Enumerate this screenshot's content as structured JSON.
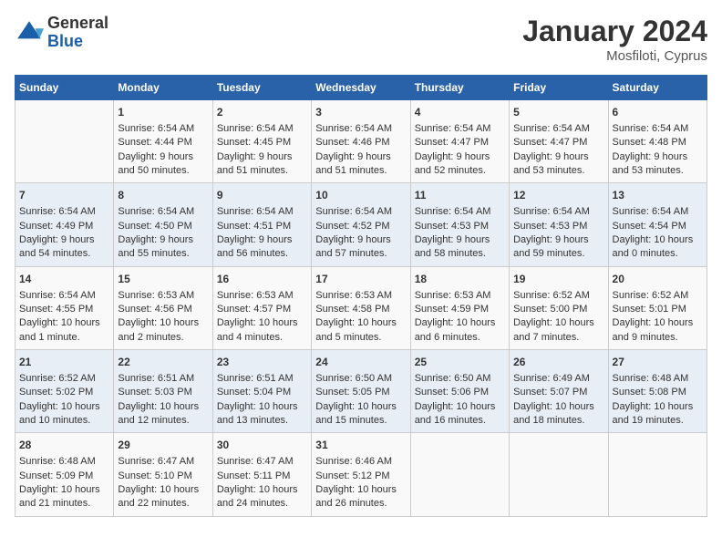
{
  "header": {
    "logo_general": "General",
    "logo_blue": "Blue",
    "month_title": "January 2024",
    "location": "Mosfiloti, Cyprus"
  },
  "weekdays": [
    "Sunday",
    "Monday",
    "Tuesday",
    "Wednesday",
    "Thursday",
    "Friday",
    "Saturday"
  ],
  "weeks": [
    [
      {
        "day": "",
        "content": ""
      },
      {
        "day": "1",
        "content": "Sunrise: 6:54 AM\nSunset: 4:44 PM\nDaylight: 9 hours\nand 50 minutes."
      },
      {
        "day": "2",
        "content": "Sunrise: 6:54 AM\nSunset: 4:45 PM\nDaylight: 9 hours\nand 51 minutes."
      },
      {
        "day": "3",
        "content": "Sunrise: 6:54 AM\nSunset: 4:46 PM\nDaylight: 9 hours\nand 51 minutes."
      },
      {
        "day": "4",
        "content": "Sunrise: 6:54 AM\nSunset: 4:47 PM\nDaylight: 9 hours\nand 52 minutes."
      },
      {
        "day": "5",
        "content": "Sunrise: 6:54 AM\nSunset: 4:47 PM\nDaylight: 9 hours\nand 53 minutes."
      },
      {
        "day": "6",
        "content": "Sunrise: 6:54 AM\nSunset: 4:48 PM\nDaylight: 9 hours\nand 53 minutes."
      }
    ],
    [
      {
        "day": "7",
        "content": "Sunrise: 6:54 AM\nSunset: 4:49 PM\nDaylight: 9 hours\nand 54 minutes."
      },
      {
        "day": "8",
        "content": "Sunrise: 6:54 AM\nSunset: 4:50 PM\nDaylight: 9 hours\nand 55 minutes."
      },
      {
        "day": "9",
        "content": "Sunrise: 6:54 AM\nSunset: 4:51 PM\nDaylight: 9 hours\nand 56 minutes."
      },
      {
        "day": "10",
        "content": "Sunrise: 6:54 AM\nSunset: 4:52 PM\nDaylight: 9 hours\nand 57 minutes."
      },
      {
        "day": "11",
        "content": "Sunrise: 6:54 AM\nSunset: 4:53 PM\nDaylight: 9 hours\nand 58 minutes."
      },
      {
        "day": "12",
        "content": "Sunrise: 6:54 AM\nSunset: 4:53 PM\nDaylight: 9 hours\nand 59 minutes."
      },
      {
        "day": "13",
        "content": "Sunrise: 6:54 AM\nSunset: 4:54 PM\nDaylight: 10 hours\nand 0 minutes."
      }
    ],
    [
      {
        "day": "14",
        "content": "Sunrise: 6:54 AM\nSunset: 4:55 PM\nDaylight: 10 hours\nand 1 minute."
      },
      {
        "day": "15",
        "content": "Sunrise: 6:53 AM\nSunset: 4:56 PM\nDaylight: 10 hours\nand 2 minutes."
      },
      {
        "day": "16",
        "content": "Sunrise: 6:53 AM\nSunset: 4:57 PM\nDaylight: 10 hours\nand 4 minutes."
      },
      {
        "day": "17",
        "content": "Sunrise: 6:53 AM\nSunset: 4:58 PM\nDaylight: 10 hours\nand 5 minutes."
      },
      {
        "day": "18",
        "content": "Sunrise: 6:53 AM\nSunset: 4:59 PM\nDaylight: 10 hours\nand 6 minutes."
      },
      {
        "day": "19",
        "content": "Sunrise: 6:52 AM\nSunset: 5:00 PM\nDaylight: 10 hours\nand 7 minutes."
      },
      {
        "day": "20",
        "content": "Sunrise: 6:52 AM\nSunset: 5:01 PM\nDaylight: 10 hours\nand 9 minutes."
      }
    ],
    [
      {
        "day": "21",
        "content": "Sunrise: 6:52 AM\nSunset: 5:02 PM\nDaylight: 10 hours\nand 10 minutes."
      },
      {
        "day": "22",
        "content": "Sunrise: 6:51 AM\nSunset: 5:03 PM\nDaylight: 10 hours\nand 12 minutes."
      },
      {
        "day": "23",
        "content": "Sunrise: 6:51 AM\nSunset: 5:04 PM\nDaylight: 10 hours\nand 13 minutes."
      },
      {
        "day": "24",
        "content": "Sunrise: 6:50 AM\nSunset: 5:05 PM\nDaylight: 10 hours\nand 15 minutes."
      },
      {
        "day": "25",
        "content": "Sunrise: 6:50 AM\nSunset: 5:06 PM\nDaylight: 10 hours\nand 16 minutes."
      },
      {
        "day": "26",
        "content": "Sunrise: 6:49 AM\nSunset: 5:07 PM\nDaylight: 10 hours\nand 18 minutes."
      },
      {
        "day": "27",
        "content": "Sunrise: 6:48 AM\nSunset: 5:08 PM\nDaylight: 10 hours\nand 19 minutes."
      }
    ],
    [
      {
        "day": "28",
        "content": "Sunrise: 6:48 AM\nSunset: 5:09 PM\nDaylight: 10 hours\nand 21 minutes."
      },
      {
        "day": "29",
        "content": "Sunrise: 6:47 AM\nSunset: 5:10 PM\nDaylight: 10 hours\nand 22 minutes."
      },
      {
        "day": "30",
        "content": "Sunrise: 6:47 AM\nSunset: 5:11 PM\nDaylight: 10 hours\nand 24 minutes."
      },
      {
        "day": "31",
        "content": "Sunrise: 6:46 AM\nSunset: 5:12 PM\nDaylight: 10 hours\nand 26 minutes."
      },
      {
        "day": "",
        "content": ""
      },
      {
        "day": "",
        "content": ""
      },
      {
        "day": "",
        "content": ""
      }
    ]
  ]
}
